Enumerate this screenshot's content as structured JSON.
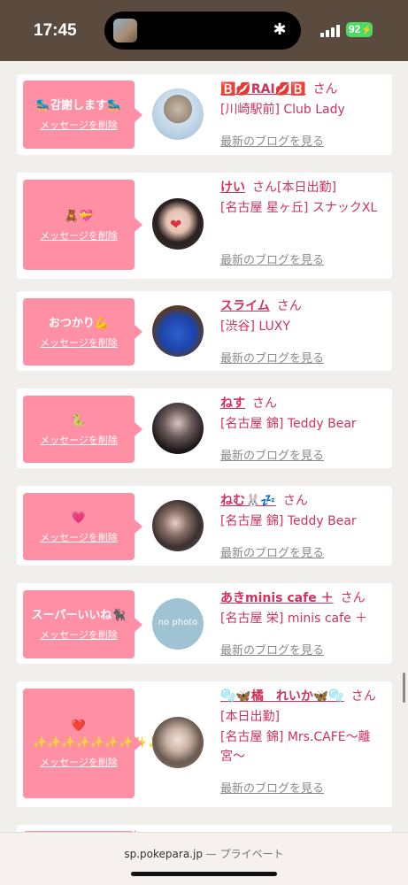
{
  "status": {
    "time": "17:45",
    "battery": "92"
  },
  "items": [
    {
      "message": "🛼감謝します🛼",
      "delete": "メッセージを削除",
      "name": "🅱️💋RAI💋🅱️",
      "san": "さん",
      "shop": "[川崎駅前] Club Lady",
      "blog": "最新のブログを見る"
    },
    {
      "message": "🧸💝",
      "delete": "メッセージを削除",
      "name": "けい",
      "san": "さん[本日出勤]",
      "shop": "[名古屋 星ヶ丘] スナックXL",
      "blog": "最新のブログを見る"
    },
    {
      "message": "おつかり💪",
      "delete": "メッセージを削除",
      "name": "スライム",
      "san": "さん",
      "shop": "[渋谷] LUXY",
      "blog": "最新のブログを見る"
    },
    {
      "message": "🐍",
      "delete": "メッセージを削除",
      "name": "ねす",
      "san": "さん",
      "shop": "[名古屋 錦] Teddy Bear",
      "blog": "最新のブログを見る"
    },
    {
      "message": "💗",
      "delete": "メッセージを削除",
      "name": "ねむ🐰💤",
      "san": "さん",
      "shop": "[名古屋 錦] Teddy Bear",
      "blog": "最新のブログを見る"
    },
    {
      "message": "スーパーいいね🐈‍⬛",
      "delete": "メッセージを削除",
      "name": "あきminis cafe ＋",
      "san": "さん",
      "shop": "[名古屋 栄] minis cafe ＋",
      "blog": "最新のブログを見る",
      "avatar_text": "no photo"
    },
    {
      "message": "❤️ ✨✨✨✨✨✨✨✨✨✨",
      "delete": "メッセージを削除",
      "name": "🫧🦋橘　れいか🦋🫧",
      "san": "さん[本日出勤]",
      "shop": "[名古屋 錦] Mrs.CAFE〜離宮〜",
      "blog": "最新のブログを見る"
    }
  ],
  "footer": {
    "url": "sp.pokepara.jp",
    "private": "— プライベート"
  }
}
